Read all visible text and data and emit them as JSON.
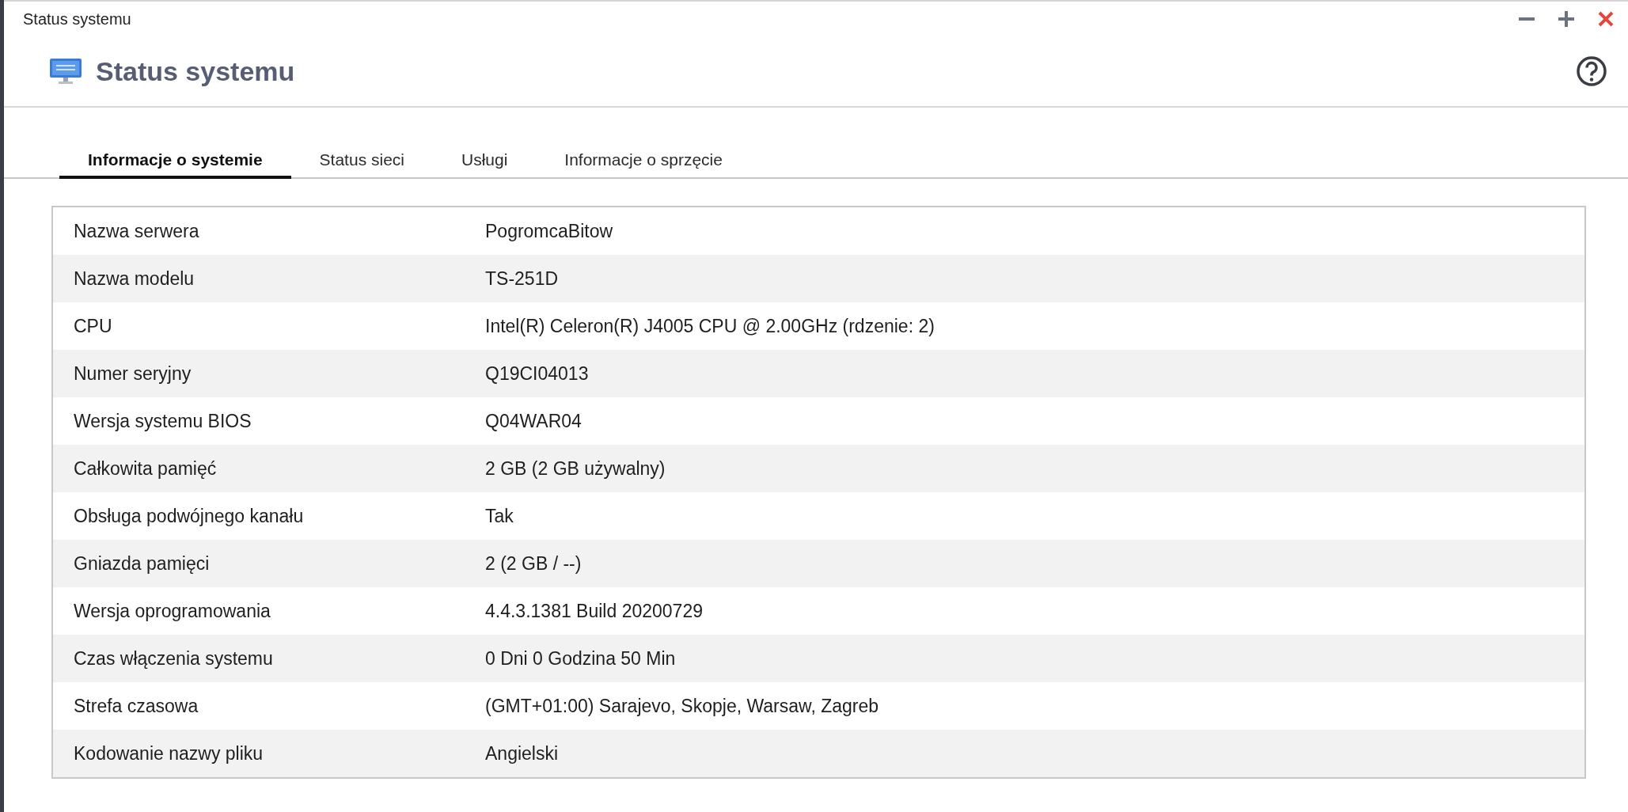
{
  "window": {
    "title": "Status systemu"
  },
  "header": {
    "title": "Status systemu"
  },
  "tabs": [
    {
      "label": "Informacje o systemie",
      "selected": true
    },
    {
      "label": "Status sieci",
      "selected": false
    },
    {
      "label": "Usługi",
      "selected": false
    },
    {
      "label": "Informacje o sprzęcie",
      "selected": false
    }
  ],
  "table": {
    "rows": [
      {
        "label": "Nazwa serwera",
        "value": "PogromcaBitow"
      },
      {
        "label": "Nazwa modelu",
        "value": "TS-251D"
      },
      {
        "label": "CPU",
        "value": "Intel(R) Celeron(R) J4005 CPU @ 2.00GHz (rdzenie: 2)"
      },
      {
        "label": "Numer seryjny",
        "value": "Q19CI04013"
      },
      {
        "label": "Wersja systemu BIOS",
        "value": "Q04WAR04"
      },
      {
        "label": "Całkowita pamięć",
        "value": "2 GB (2 GB używalny)"
      },
      {
        "label": "Obsługa podwójnego kanału",
        "value": "Tak"
      },
      {
        "label": "Gniazda pamięci",
        "value": "2 (2 GB / --)"
      },
      {
        "label": "Wersja oprogramowania",
        "value": "4.4.3.1381 Build 20200729"
      },
      {
        "label": "Czas włączenia systemu",
        "value": "0 Dni 0 Godzina 50 Min"
      },
      {
        "label": "Strefa czasowa",
        "value": "(GMT+01:00) Sarajevo, Skopje, Warsaw, Zagreb"
      },
      {
        "label": "Kodowanie nazwy pliku",
        "value": "Angielski"
      }
    ]
  }
}
